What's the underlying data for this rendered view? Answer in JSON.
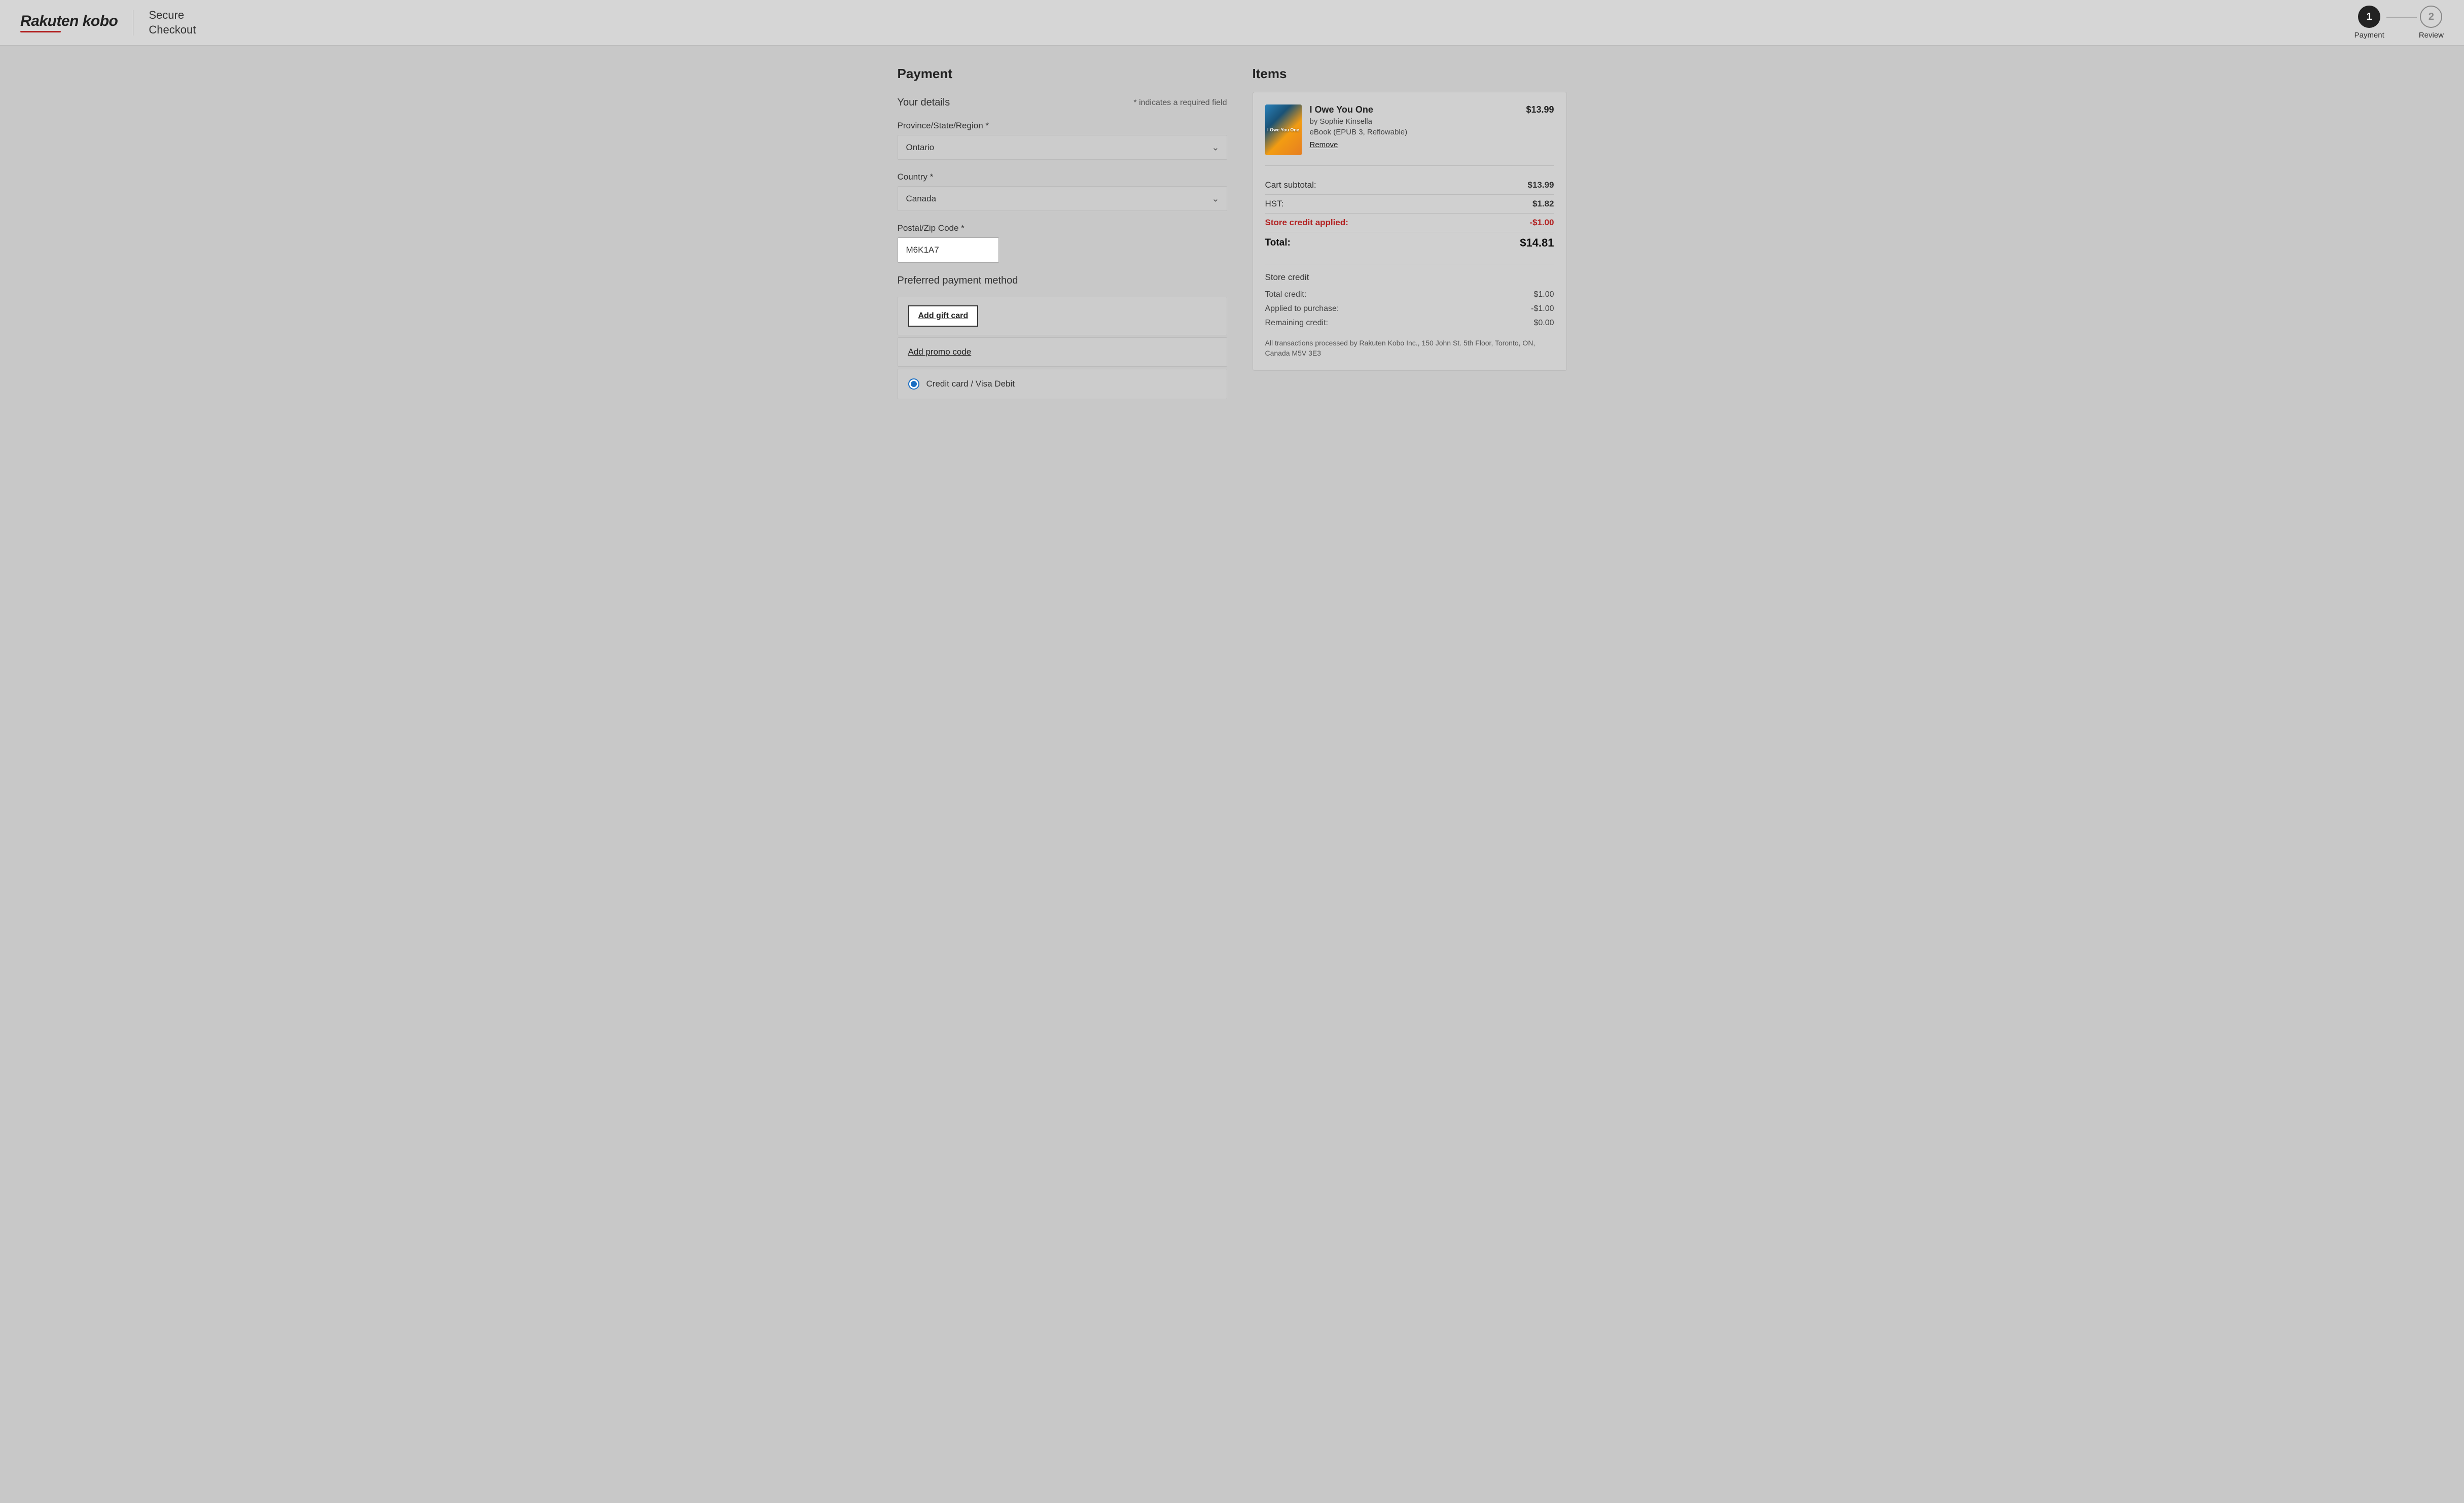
{
  "header": {
    "logo_text": "Rakuten kobo",
    "secure_checkout": "Secure\nCheckout",
    "step1_number": "1",
    "step1_label": "Payment",
    "step2_number": "2",
    "step2_label": "Review"
  },
  "left": {
    "section_title": "Payment",
    "your_details_label": "Your details",
    "required_note": "* indicates a required field",
    "province_label": "Province/State/Region *",
    "province_value": "Ontario",
    "country_label": "Country *",
    "country_value": "Canada",
    "postal_label": "Postal/Zip Code *",
    "postal_value": "M6K1A7",
    "pref_payment_title": "Preferred payment method",
    "add_gift_card_label": "Add gift card",
    "add_promo_label": "Add promo code",
    "credit_card_label": "Credit card / Visa Debit"
  },
  "right": {
    "items_title": "Items",
    "book_title": "I Owe You One",
    "book_author": "by Sophie Kinsella",
    "book_format": "eBook (EPUB 3, Reflowable)",
    "book_price": "$13.99",
    "remove_label": "Remove",
    "cart_subtotal_label": "Cart subtotal:",
    "cart_subtotal_value": "$13.99",
    "hst_label": "HST:",
    "hst_value": "$1.82",
    "store_credit_applied_label": "Store credit applied:",
    "store_credit_applied_value": "-$1.00",
    "total_label": "Total:",
    "total_value": "$14.81",
    "store_credit_section_title": "Store credit",
    "total_credit_label": "Total credit:",
    "total_credit_value": "$1.00",
    "applied_label": "Applied to purchase:",
    "applied_value": "-$1.00",
    "remaining_label": "Remaining credit:",
    "remaining_value": "$0.00",
    "transaction_note": "All transactions processed by Rakuten Kobo Inc., 150 John St. 5th Floor, Toronto, ON, Canada M5V 3E3"
  }
}
